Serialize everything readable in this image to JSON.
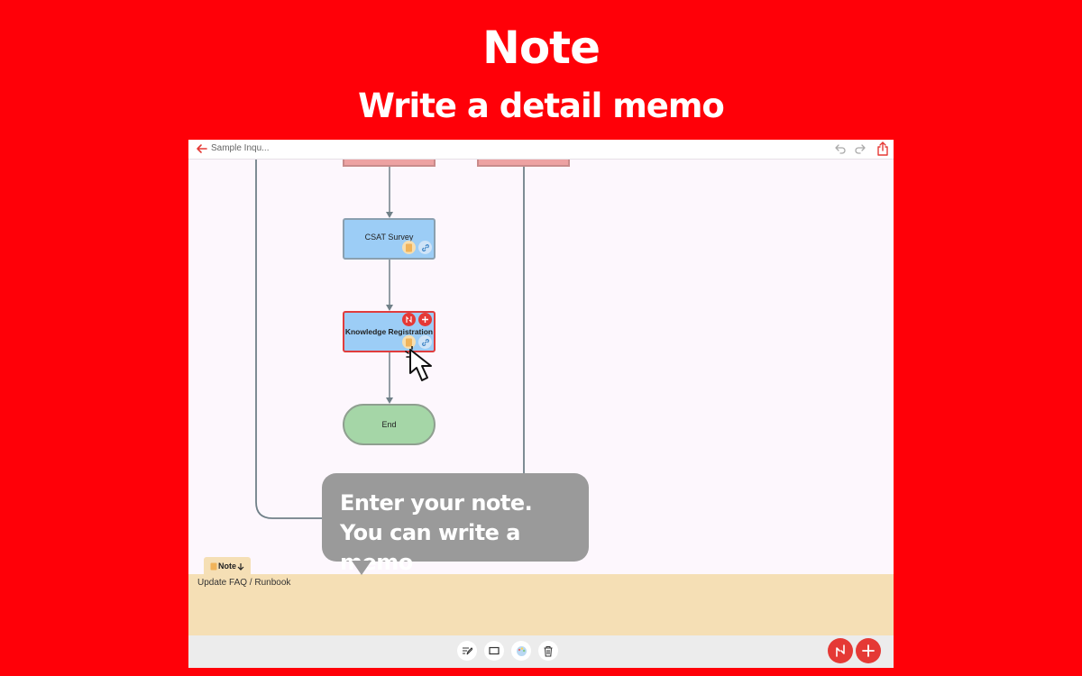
{
  "promo": {
    "title": "Note",
    "subtitle": "Write a detail memo"
  },
  "header": {
    "document_title": "Sample Inqu..."
  },
  "flowchart": {
    "nodes": [
      {
        "label": "CSAT Survey",
        "color": "#9ccdf6"
      },
      {
        "label": "Knowledge Registration",
        "color": "#9ccdf6",
        "selected": true
      },
      {
        "label": "End",
        "color": "#a5d6a7",
        "shape": "terminal"
      }
    ]
  },
  "note": {
    "tab_label": "Note",
    "content": "Update FAQ / Runbook"
  },
  "tooltip": {
    "line1": "Enter your note.",
    "line2": "You can write a memo"
  },
  "toolbar": {
    "tools": [
      "edit-icon",
      "rectangle-icon",
      "palette-icon",
      "trash-icon"
    ],
    "fabs": [
      "branch-icon",
      "plus-icon"
    ]
  },
  "colors": {
    "brand_red": "#ff0008",
    "accent_red": "#e53935",
    "note_bg": "#f5dfb5"
  }
}
